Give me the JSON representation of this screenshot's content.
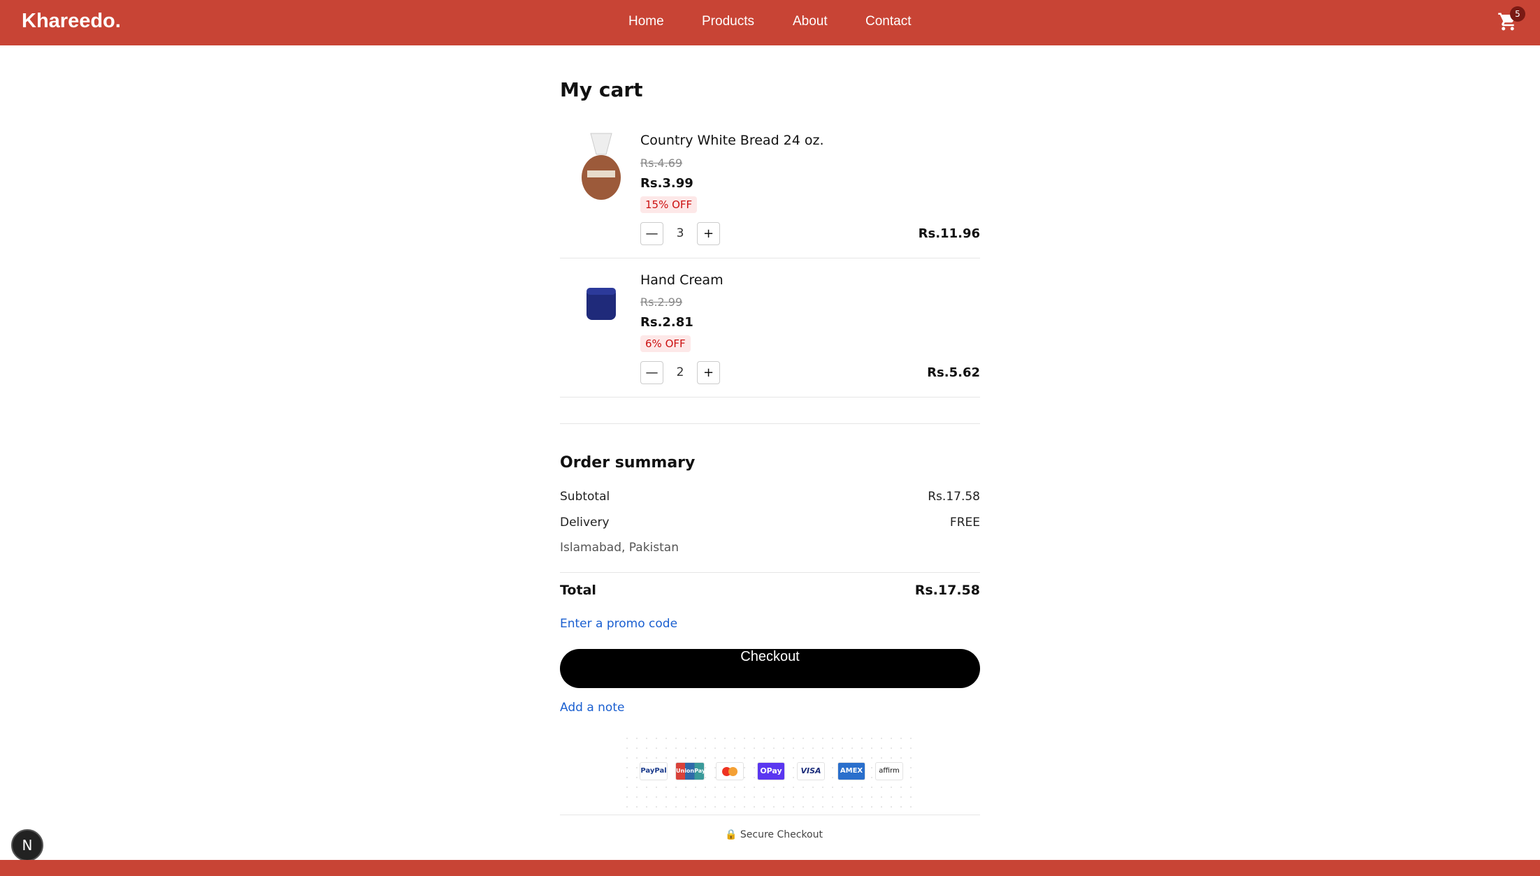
{
  "header": {
    "logo": "Khareedo.",
    "nav": [
      "Home",
      "Products",
      "About",
      "Contact"
    ],
    "cart_count": "5"
  },
  "cart": {
    "title": "My cart",
    "items": [
      {
        "name": "Country White Bread 24 oz.",
        "old_price": "Rs.4.69",
        "price": "Rs.3.99",
        "discount": "15% OFF",
        "qty": "3",
        "line_total": "Rs.11.96",
        "minus": "—",
        "plus": "+"
      },
      {
        "name": "Hand Cream",
        "old_price": "Rs.2.99",
        "price": "Rs.2.81",
        "discount": "6% OFF",
        "qty": "2",
        "line_total": "Rs.5.62",
        "minus": "—",
        "plus": "+"
      }
    ]
  },
  "summary": {
    "title": "Order summary",
    "subtotal_label": "Subtotal",
    "subtotal": "Rs.17.58",
    "delivery_label": "Delivery",
    "delivery": "FREE",
    "location": "Islamabad, Pakistan",
    "total_label": "Total",
    "total": "Rs.17.58",
    "promo": "Enter a promo code",
    "checkout": "Checkout",
    "note": "Add a note"
  },
  "payments": [
    "PayPal",
    "UnionPay",
    "Mastercard",
    "OPay",
    "VISA",
    "AMEX",
    "affirm"
  ],
  "secure": "Secure Checkout",
  "dev_badge": "N"
}
